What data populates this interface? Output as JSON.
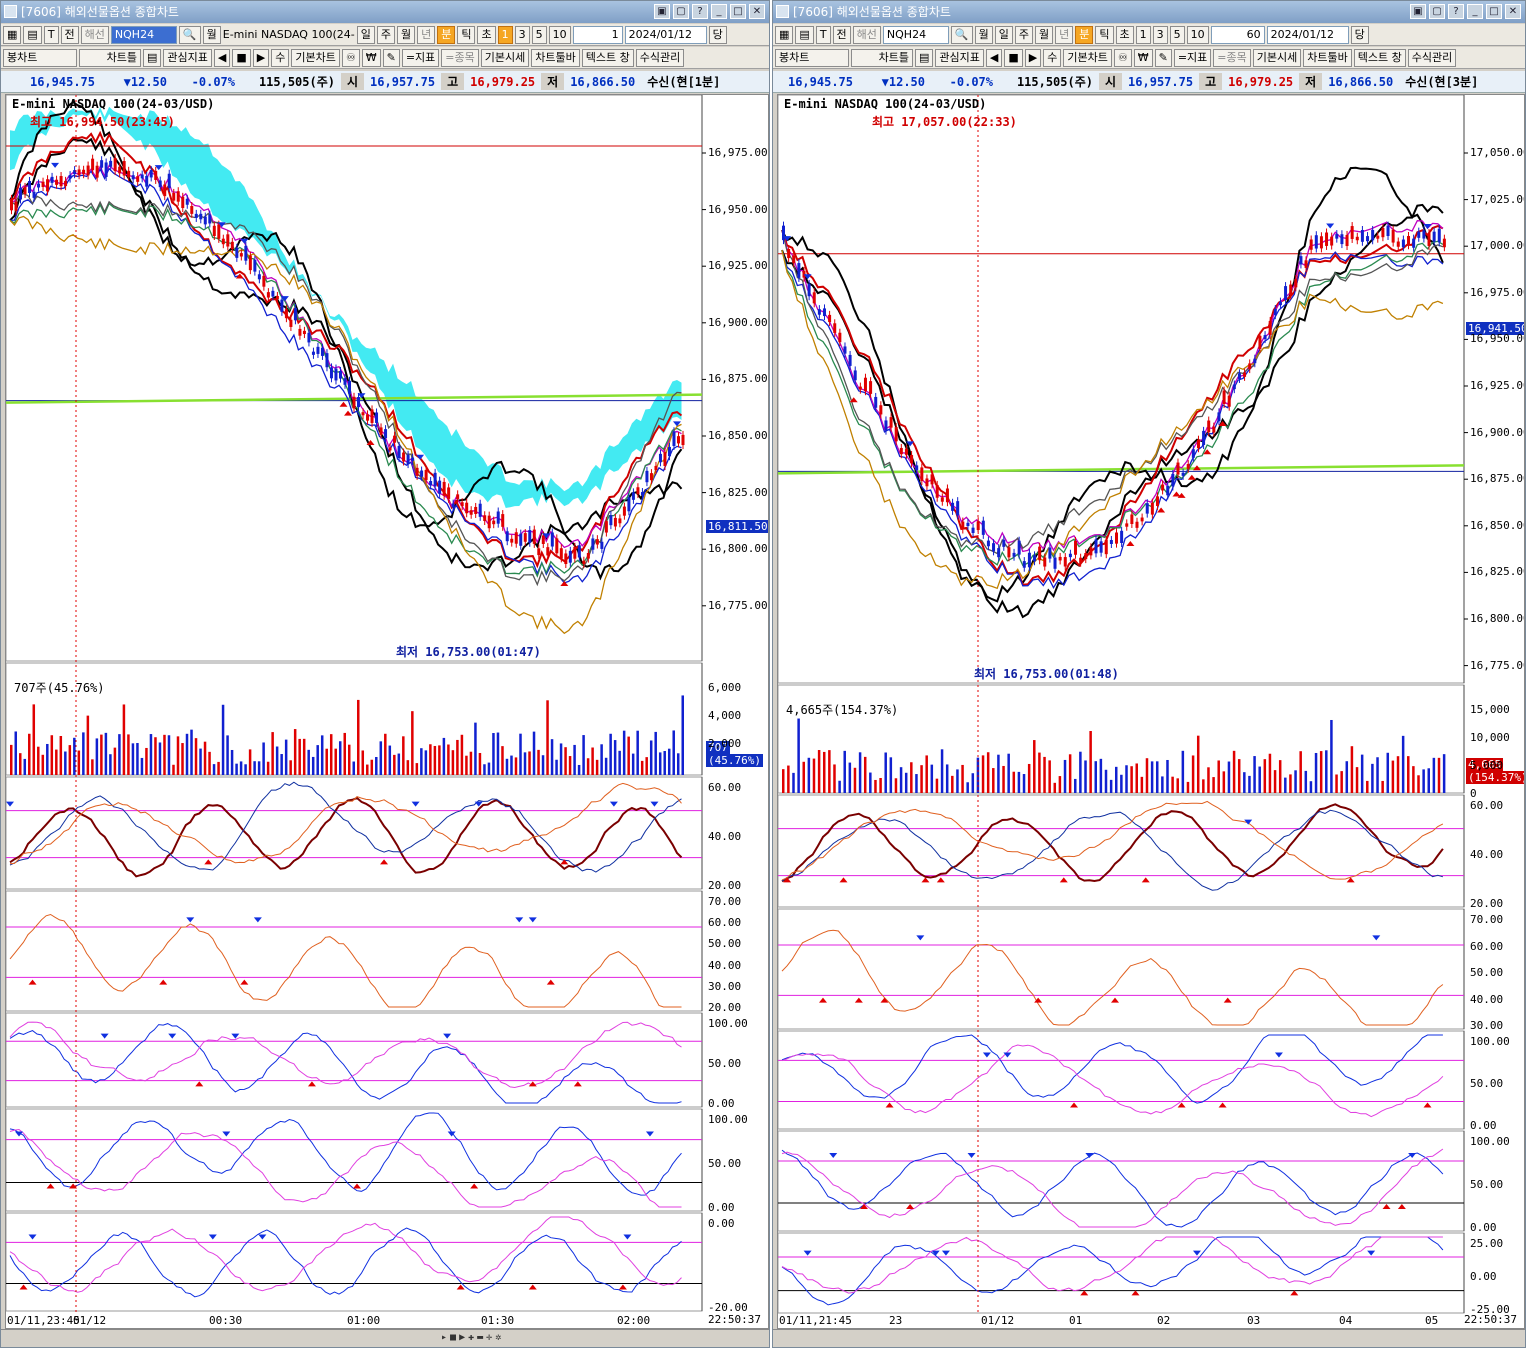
{
  "colors": {
    "up": "#e00000",
    "down": "#1020d0",
    "ichimoku": "#22e6f0",
    "ichimoku2": "#f59a30",
    "ma_green": "#88e030",
    "magenta": "#e020e0"
  },
  "left": {
    "title": "[7606] 해외선물옵션 종합차트",
    "window_buttons": [
      "▣",
      "▢",
      "?",
      "_",
      "□",
      "✕"
    ],
    "toolbar1": {
      "btn_a": "해선",
      "symbol": "NQH24",
      "product": "E-mini NASDAQ 100(24-",
      "periods": [
        "일",
        "주",
        "월",
        "년",
        "분",
        "틱",
        "초"
      ],
      "selected_period": "분",
      "nums": [
        "1",
        "3",
        "5",
        "10"
      ],
      "selected_num": "1",
      "interval": "1",
      "date": "2024/01/12",
      "apply": "당"
    },
    "toolbar2": [
      "봉차트",
      "차트틀",
      "관심지표",
      "수",
      "기본차트",
      "=지표",
      "=종목",
      "기본시세",
      "차트툴바",
      "텍스트 창",
      "수식관리"
    ],
    "quote": {
      "price": "16,945.75",
      "change": "▼12.50",
      "pct": "-0.07%",
      "volume": "115,505(주)",
      "open_label": "시",
      "open": "16,957.75",
      "high_label": "고",
      "high": "16,979.25",
      "low_label": "저",
      "low": "16,866.50",
      "mode": "수신(현[1분]"
    },
    "chart_title": "E-mini NASDAQ 100(24-03/USD)",
    "high_note": "최고 16,994.50(23:45)",
    "low_note": "최저 16,753.00(01:47)",
    "price_ticks": [
      "16,975.00",
      "16,950.00",
      "16,925.00",
      "16,900.00",
      "16,875.00",
      "16,850.00",
      "16,825.00",
      "16,800.00",
      "16,775.00"
    ],
    "last_price": "16,811.50",
    "volume_note": "707주(45.76%)",
    "volume_ticks": [
      "6,000",
      "4,000",
      "2,000"
    ],
    "volume_box": [
      "707",
      "(45.76%)"
    ],
    "ind1_ticks": [
      "60.00",
      "40.00",
      "20.00"
    ],
    "ind2_ticks": [
      "70.00",
      "60.00",
      "50.00",
      "40.00",
      "30.00",
      "20.00"
    ],
    "ind3_ticks": [
      "100.00",
      "50.00",
      "0.00"
    ],
    "ind4_ticks": [
      "100.00",
      "50.00",
      "0.00"
    ],
    "ind5_ticks": [
      "0.00",
      "-20.00"
    ],
    "xlabels": [
      "01/11,23:45",
      "01/12",
      "00:30",
      "01:00",
      "01:30",
      "02:00"
    ],
    "clock": "22:50:37"
  },
  "right": {
    "title": "[7606] 해외선물옵션 종합차트",
    "window_buttons": [
      "▣",
      "▢",
      "?",
      "_",
      "□",
      "✕"
    ],
    "toolbar1": {
      "btn_a": "해선",
      "symbol": "NQH24",
      "periods": [
        "일",
        "주",
        "월",
        "년",
        "분",
        "틱",
        "초"
      ],
      "selected_period": "분",
      "nums": [
        "1",
        "3",
        "5",
        "10"
      ],
      "interval": "60",
      "date": "2024/01/12",
      "apply": "당"
    },
    "toolbar2": [
      "봉차트",
      "차트틀",
      "관심지표",
      "수",
      "기본차트",
      "=지표",
      "=종목",
      "기본시세",
      "차트툴바",
      "텍스트 창",
      "수식관리"
    ],
    "quote": {
      "price": "16,945.75",
      "change": "▼12.50",
      "pct": "-0.07%",
      "volume": "115,505(주)",
      "open_label": "시",
      "open": "16,957.75",
      "high_label": "고",
      "high": "16,979.25",
      "low_label": "저",
      "low": "16,866.50",
      "mode": "수신(현[3분]"
    },
    "chart_title": "E-mini NASDAQ 100(24-03/USD)",
    "high_note": "최고 17,057.00(22:33)",
    "low_note": "최저 16,753.00(01:48)",
    "price_ticks": [
      "17,050.00",
      "17,025.00",
      "17,000.00",
      "16,975.00",
      "16,950.00",
      "16,925.00",
      "16,900.00",
      "16,875.00",
      "16,850.00",
      "16,825.00",
      "16,800.00",
      "16,775.00"
    ],
    "last_price": "16,941.50",
    "volume_note": "4,665주(154.37%)",
    "volume_ticks": [
      "15,000",
      "10,000",
      "5,000",
      "0"
    ],
    "volume_box": [
      "4,665",
      "(154.37%)"
    ],
    "ind1_ticks": [
      "60.00",
      "40.00",
      "20.00"
    ],
    "ind2_ticks": [
      "70.00",
      "60.00",
      "50.00",
      "40.00",
      "30.00"
    ],
    "ind3_ticks": [
      "100.00",
      "50.00",
      "0.00"
    ],
    "ind4_ticks": [
      "100.00",
      "50.00",
      "0.00"
    ],
    "ind5_ticks": [
      "25.00",
      "0.00",
      "-25.00"
    ],
    "xlabels": [
      "01/11,21:45",
      "23",
      "01/12",
      "01",
      "02",
      "03",
      "04",
      "05"
    ],
    "clock": "22:50:37"
  }
}
